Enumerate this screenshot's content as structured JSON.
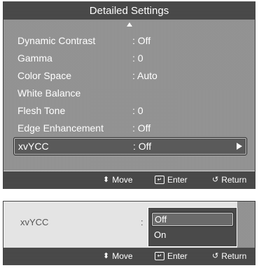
{
  "menu": {
    "title": "Detailed Settings",
    "items": [
      {
        "label": "Dynamic Contrast",
        "value": ": Off"
      },
      {
        "label": "Gamma",
        "value": ": 0"
      },
      {
        "label": "Color Space",
        "value": ": Auto"
      },
      {
        "label": "White Balance",
        "value": ""
      },
      {
        "label": "Flesh Tone",
        "value": ": 0"
      },
      {
        "label": "Edge Enhancement",
        "value": ": Off"
      },
      {
        "label": "xvYCC",
        "value": ": Off"
      }
    ],
    "selected_index": 6
  },
  "footer": {
    "move_label": "Move",
    "enter_label": "Enter",
    "return_label": "Return"
  },
  "submenu": {
    "label": "xvYCC",
    "colon": ":",
    "options": [
      "Off",
      "On"
    ],
    "selected_index": 0
  },
  "icons": {
    "up": "triangle-up-icon",
    "right": "triangle-right-icon",
    "move": "updown-arrows-icon",
    "enter": "enter-icon",
    "return": "return-icon"
  }
}
